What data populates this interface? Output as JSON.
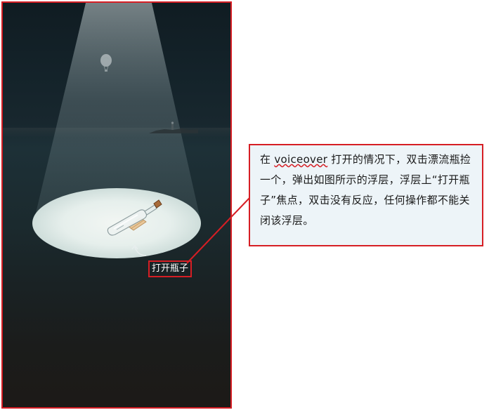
{
  "phone": {
    "button_label": "打开瓶子"
  },
  "note": {
    "prefix": "在 ",
    "voiceover": "voiceover",
    "suffix": " 打开的情况下，双击漂流瓶捡一个，弹出如图所示的浮层，浮层上“打开瓶子”焦点，双击没有反应，任何操作都不能关闭该浮层。"
  },
  "colors": {
    "annotation_red": "#d61e24",
    "note_background": "#edf4f8"
  }
}
